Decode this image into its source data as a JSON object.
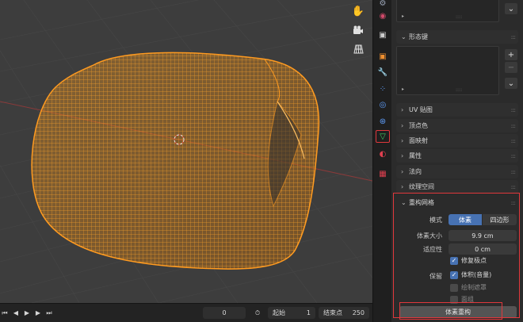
{
  "viewport": {
    "tools": [
      "hand-icon",
      "camera-icon",
      "grid-icon"
    ]
  },
  "timeline": {
    "current_frame": "0",
    "start_label": "起始",
    "start_value": "1",
    "end_label": "结束点",
    "end_value": "250"
  },
  "properties": {
    "shape_keys_title": "形态键",
    "collapsed_sections": [
      "UV 贴图",
      "顶点色",
      "面映射",
      "属性",
      "法向",
      "纹理空间"
    ],
    "remesh": {
      "title": "重构网格",
      "mode_label": "模式",
      "mode_options": [
        "体素",
        "四边形"
      ],
      "mode_selected": "体素",
      "voxel_size_label": "体素大小",
      "voxel_size_value": "9.9 cm",
      "adaptivity_label": "适应性",
      "adaptivity_value": "0 cm",
      "fix_poles_label": "修复极点",
      "preserve_label": "保留",
      "volume_label": "体积(音量)",
      "paint_mask_label": "绘制遮罩",
      "face_sets_label": "面组",
      "apply_button": "体素重构"
    }
  },
  "colors": {
    "accent_blue": "#4772b3",
    "wire_orange": "#ff9a1f",
    "highlight_red": "#e0383c"
  }
}
